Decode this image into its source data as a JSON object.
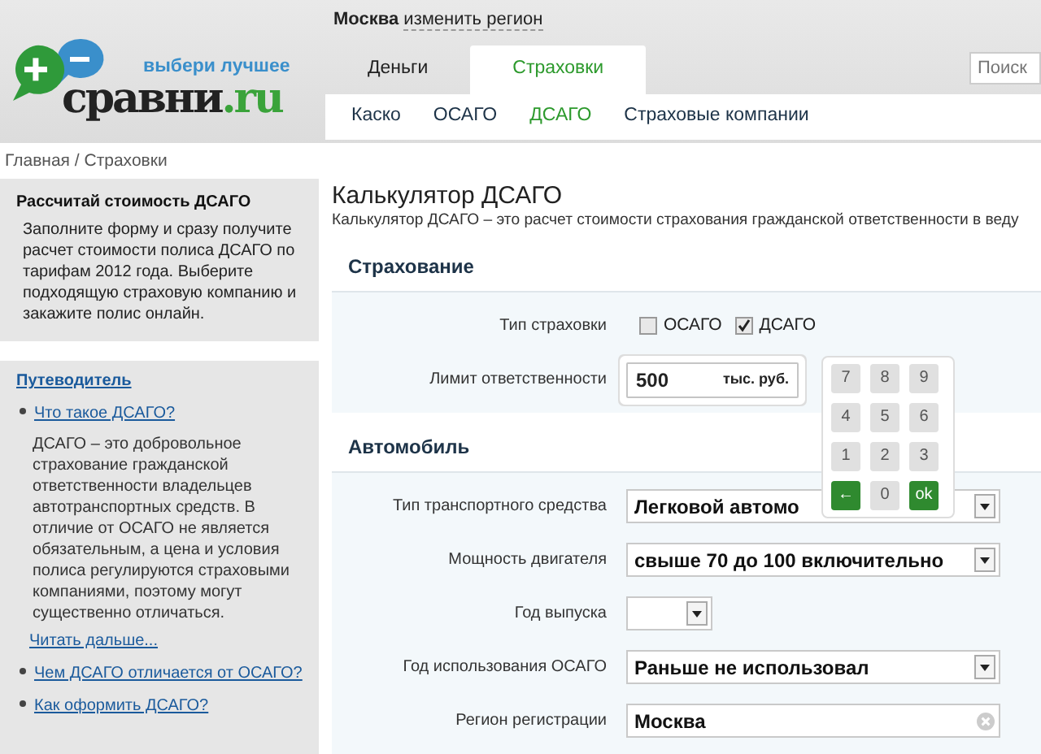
{
  "header": {
    "logo": {
      "tagline": "выбери лучшее",
      "name": "сравни",
      "tld": ".ru"
    },
    "region": {
      "city": "Москва",
      "change_link": "изменить регион"
    },
    "tabs": [
      {
        "label": "Деньги",
        "selected": false
      },
      {
        "label": "Страховки",
        "selected": true
      }
    ],
    "subnav": [
      {
        "label": "Каско",
        "selected": false
      },
      {
        "label": "ОСАГО",
        "selected": false
      },
      {
        "label": "ДСАГО",
        "selected": true
      },
      {
        "label": "Страховые компании",
        "selected": false
      }
    ],
    "search": {
      "placeholder": "Поиск"
    }
  },
  "breadcrumb": {
    "items": [
      "Главная",
      "Страховки"
    ],
    "separator": "/"
  },
  "sidebar": {
    "promo": {
      "title": "Рассчитай стоимость ДСАГО",
      "text": "Заполните форму и сразу получите расчет стоимости полиса ДСАГО по тарифам 2012 года. Выберите подходящую страховую компанию и закажите полис онлайн."
    },
    "guide": {
      "title": "Путеводитель",
      "items": [
        {
          "link": "Что такое ДСАГО?",
          "expanded": true,
          "text": "ДСАГО – это добровольное страхование гражданской ответственности владельцев автотранспортных средств. В отличие от ОСАГО не является обязательным, а цена и условия полиса регулируются страховыми компаниями, поэтому могут существенно отличаться.",
          "more": "Читать дальше..."
        },
        {
          "link": "Чем ДСАГО отличается от ОСАГО?",
          "expanded": false
        },
        {
          "link": "Как оформить ДСАГО?",
          "expanded": false
        }
      ]
    }
  },
  "main": {
    "title": "Калькулятор ДСАГО",
    "subtitle": "Калькулятор ДСАГО – это расчет стоимости страхования гражданской ответственности в веду",
    "sections": [
      {
        "title": "Страхование",
        "fields": [
          {
            "kind": "checkboxes",
            "label": "Тип страховки",
            "options": [
              {
                "label": "ОСАГО",
                "checked": false
              },
              {
                "label": "ДСАГО",
                "checked": true
              }
            ]
          },
          {
            "kind": "limit",
            "label": "Лимит ответственности",
            "value": "500",
            "unit": "тыс. руб.",
            "keypad": [
              {
                "kind": "digit",
                "label": "7"
              },
              {
                "kind": "digit",
                "label": "8"
              },
              {
                "kind": "digit",
                "label": "9"
              },
              {
                "kind": "digit",
                "label": "4"
              },
              {
                "kind": "digit",
                "label": "5"
              },
              {
                "kind": "digit",
                "label": "6"
              },
              {
                "kind": "digit",
                "label": "1"
              },
              {
                "kind": "digit",
                "label": "2"
              },
              {
                "kind": "digit",
                "label": "3"
              },
              {
                "kind": "back",
                "label": "←"
              },
              {
                "kind": "digit",
                "label": "0"
              },
              {
                "kind": "ok",
                "label": "ok"
              }
            ]
          }
        ]
      },
      {
        "title": "Автомобиль",
        "fields": [
          {
            "kind": "select",
            "label": "Тип транспортного средства",
            "value": "Легковой автомо"
          },
          {
            "kind": "select",
            "label": "Мощность двигателя",
            "value": "свыше 70 до 100 включительно"
          },
          {
            "kind": "select-short",
            "label": "Год выпуска"
          },
          {
            "kind": "select",
            "label": "Год использования ОСАГО",
            "value": "Раньше не использовал"
          },
          {
            "kind": "text",
            "label": "Регион регистрации",
            "value": "Москва"
          }
        ]
      }
    ]
  }
}
